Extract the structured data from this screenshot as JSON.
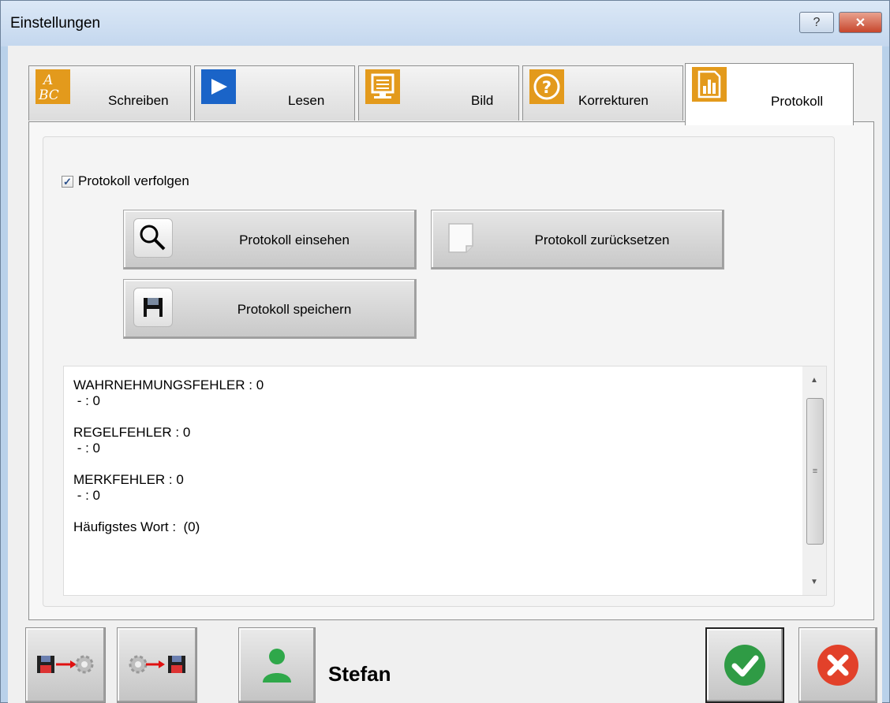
{
  "window": {
    "title": "Einstellungen",
    "help_label": "?",
    "close_label": "✕"
  },
  "tabs": [
    {
      "label": "Schreiben",
      "icon": "abc-icon",
      "active": false
    },
    {
      "label": "Lesen",
      "icon": "play-icon",
      "active": false
    },
    {
      "label": "Bild",
      "icon": "monitor-icon",
      "active": false
    },
    {
      "label": "Korrekturen",
      "icon": "question-icon",
      "active": false
    },
    {
      "label": "Protokoll",
      "icon": "chart-icon",
      "active": true
    }
  ],
  "protokoll": {
    "track_label": "Protokoll verfolgen",
    "track_checked": true,
    "view_label": "Protokoll einsehen",
    "reset_label": "Protokoll zurücksetzen",
    "save_label": "Protokoll speichern"
  },
  "log": {
    "lines": [
      "WAHRNEHMUNGSFEHLER : 0",
      " - : 0",
      "",
      "REGELFEHLER : 0",
      " - : 0",
      "",
      "MERKFEHLER : 0",
      " - : 0",
      "",
      "Häufigstes Wort :  (0)"
    ]
  },
  "footer": {
    "user_name": "Stefan"
  },
  "colors": {
    "orange": "#e39a1c",
    "blue": "#1a64c8",
    "ok_green": "#2f9b45",
    "cancel_red": "#e2412a"
  }
}
